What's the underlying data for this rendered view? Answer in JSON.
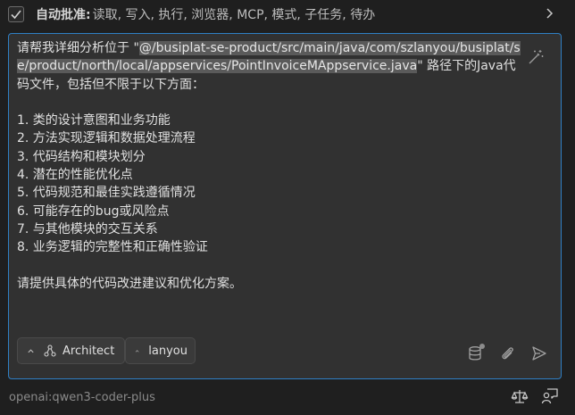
{
  "auto_approve": {
    "checked": true,
    "label": "自动批准:",
    "items": " 读取, 写入, 执行, 浏览器, MCP, 模式, 子任务, 待办"
  },
  "message": {
    "prefix": "请帮我详细分析位于 \"",
    "mention": "@/busiplat-se-product/src/main/java/com/szlanyou/busiplat/se/product/north/local/appservices/PointInvoiceMAppservice.java",
    "suffix": "\" 路径下的Java代码文件，包括但不限于以下方面：\n\n1. 类的设计意图和业务功能\n2. 方法实现逻辑和数据处理流程\n3. 代码结构和模块划分\n4. 潜在的性能优化点\n5. 代码规范和最佳实践遵循情况\n6. 可能存在的bug或风险点\n7. 与其他模块的交互关系\n8. 业务逻辑的完整性和正确性验证\n\n请提供具体的代码改进建议和优化方案。"
  },
  "chips": {
    "mode_label": "Architect",
    "profile_label": "lanyou"
  },
  "footer": {
    "model": "openai:qwen3-coder-plus"
  },
  "icons": {
    "checkbox": "checkmark-icon",
    "expand": "chevron-right-icon",
    "enhance": "magic-wand-icon",
    "mode": "architecture-icon",
    "context": "database-icon",
    "attach": "paperclip-icon",
    "send": "send-icon",
    "balance": "scales-icon",
    "feedback": "chat-person-icon"
  },
  "colors": {
    "accent_border": "#2f7fc4",
    "composer_bg": "#313131",
    "page_bg": "#1f1f1f",
    "mention_bg": "#5a5a5a"
  }
}
